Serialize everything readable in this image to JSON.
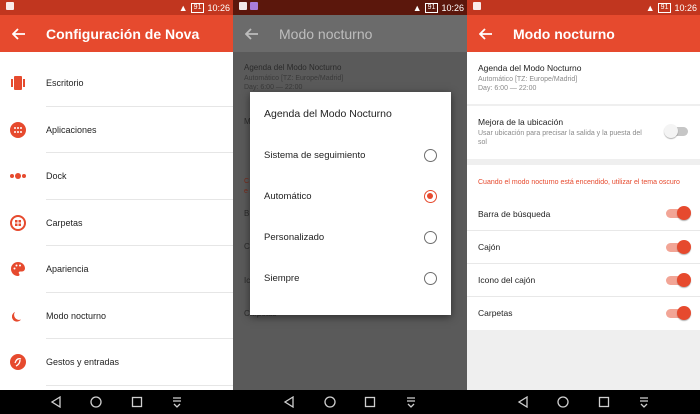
{
  "status": {
    "time": "10:26",
    "battery": "91"
  },
  "screen1": {
    "title": "Configuración de Nova",
    "items": [
      {
        "label": "Escritorio",
        "icon": "desktop-icon"
      },
      {
        "label": "Aplicaciones",
        "icon": "apps-grid-icon"
      },
      {
        "label": "Dock",
        "icon": "dock-icon"
      },
      {
        "label": "Carpetas",
        "icon": "folder-icon"
      },
      {
        "label": "Apariencia",
        "icon": "palette-icon"
      },
      {
        "label": "Modo nocturno",
        "icon": "moon-icon"
      },
      {
        "label": "Gestos y entradas",
        "icon": "gestures-icon"
      }
    ]
  },
  "screen2": {
    "title": "Modo nocturno",
    "background": {
      "schedule_title": "Agenda del Modo Nocturno",
      "schedule_sub1": "Automático [TZ: Europe/Madrid]",
      "schedule_sub2": "Day: 6:00 — 22:00",
      "partial_m": "M",
      "partial_c": "C",
      "partial_e": "e",
      "partial_b": "B",
      "partial_c2": "C",
      "partial_ic": "Ic",
      "carpetas": "Carpetas"
    },
    "dialog": {
      "title": "Agenda del Modo Nocturno",
      "options": [
        {
          "label": "Sistema de seguimiento",
          "selected": false
        },
        {
          "label": "Automático",
          "selected": true
        },
        {
          "label": "Personalizado",
          "selected": false
        },
        {
          "label": "Siempre",
          "selected": false
        }
      ]
    }
  },
  "screen3": {
    "title": "Modo nocturno",
    "schedule": {
      "title": "Agenda del Modo Nocturno",
      "sub1": "Automático [TZ: Europe/Madrid]",
      "sub2": "Day: 6:00 — 22:00"
    },
    "location": {
      "title": "Mejora de la ubicación",
      "sub": "Usar ubicación para precisar la salida y la puesta del sol",
      "enabled": false
    },
    "section_header": "Cuando el modo nocturno está encendido, utilizar el tema oscuro",
    "toggles": [
      {
        "label": "Barra de búsqueda",
        "enabled": true
      },
      {
        "label": "Cajón",
        "enabled": true
      },
      {
        "label": "Icono del cajón",
        "enabled": true
      },
      {
        "label": "Carpetas",
        "enabled": true
      }
    ]
  },
  "colors": {
    "accent": "#e64a2e",
    "statusbar": "#c1361f"
  }
}
